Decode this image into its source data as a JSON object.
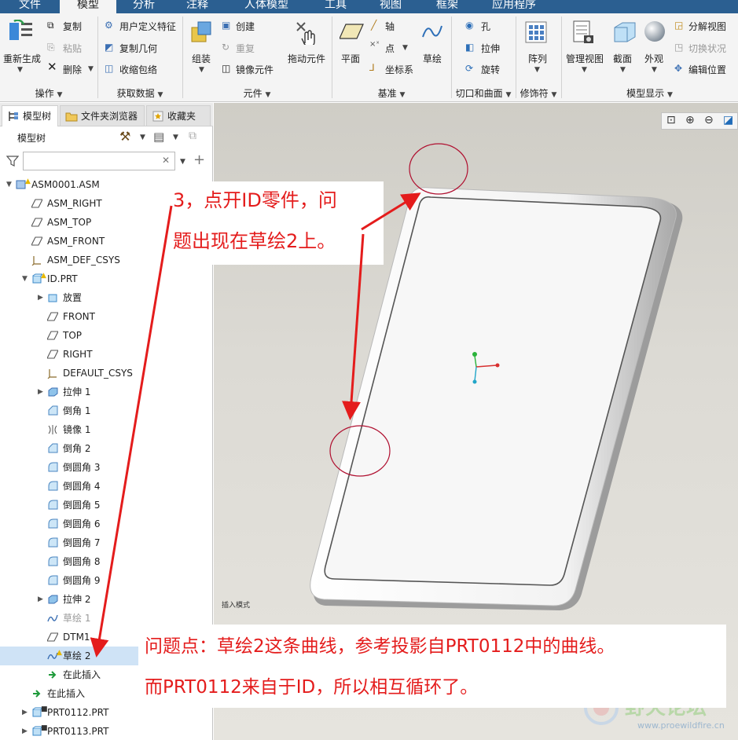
{
  "tabs": [
    "文件",
    "模型",
    "分析",
    "注释",
    "人体模型",
    "工具",
    "视图",
    "框架",
    "应用程序"
  ],
  "ribbon": {
    "operations": {
      "regen": "重新生成",
      "copy": "复制",
      "paste": "粘贴",
      "delete": "删除",
      "group": "操作"
    },
    "get_data": {
      "udf": "用户定义特征",
      "copy_geom": "复制几何",
      "shrinkwrap": "收缩包络",
      "group": "获取数据"
    },
    "component": {
      "assemble": "组装",
      "create": "创建",
      "repeat": "重复",
      "mirror": "镜像元件",
      "drag": "拖动元件",
      "group": "元件"
    },
    "datum": {
      "plane": "平面",
      "axis": "轴",
      "point": "点",
      "csys": "坐标系",
      "sketch": "草绘",
      "group": "基准"
    },
    "cut_surface": {
      "hole": "孔",
      "extrude": "拉伸",
      "revolve": "旋转",
      "group": "切口和曲面"
    },
    "modifier": {
      "pattern": "阵列",
      "group": "修饰符"
    },
    "model_display": {
      "manage_views": "管理视图",
      "section": "截面",
      "appearance": "外观",
      "explode": "分解视图",
      "toggle_status": "切换状况",
      "edit_position": "编辑位置",
      "group": "模型显示"
    }
  },
  "panel_tabs": [
    "模型树",
    "文件夹浏览器",
    "收藏夹"
  ],
  "tree_title": "模型树",
  "search": {
    "value": "",
    "placeholder": ""
  },
  "tree": [
    {
      "label": "ASM0001.ASM",
      "icon": "assembly-icon",
      "indent": 0,
      "expanded": true,
      "warn": true
    },
    {
      "label": "ASM_RIGHT",
      "icon": "datum-plane-icon",
      "indent": 1
    },
    {
      "label": "ASM_TOP",
      "icon": "datum-plane-icon",
      "indent": 1
    },
    {
      "label": "ASM_FRONT",
      "icon": "datum-plane-icon",
      "indent": 1
    },
    {
      "label": "ASM_DEF_CSYS",
      "icon": "csys-icon",
      "indent": 1
    },
    {
      "label": "ID.PRT",
      "icon": "part-icon",
      "indent": 1,
      "expanded": true,
      "warn": true
    },
    {
      "label": "放置",
      "icon": "placement-icon",
      "indent": 2,
      "collapsed": true
    },
    {
      "label": "FRONT",
      "icon": "datum-plane-icon",
      "indent": 2
    },
    {
      "label": "TOP",
      "icon": "datum-plane-icon",
      "indent": 2
    },
    {
      "label": "RIGHT",
      "icon": "datum-plane-icon",
      "indent": 2
    },
    {
      "label": "DEFAULT_CSYS",
      "icon": "csys-icon",
      "indent": 2
    },
    {
      "label": "拉伸 1",
      "icon": "extrude-icon",
      "indent": 2,
      "collapsed": true
    },
    {
      "label": "倒角 1",
      "icon": "chamfer-icon",
      "indent": 2
    },
    {
      "label": "镜像 1",
      "icon": "mirror-icon",
      "indent": 2
    },
    {
      "label": "倒角 2",
      "icon": "chamfer-icon",
      "indent": 2
    },
    {
      "label": "倒圆角 3",
      "icon": "round-icon",
      "indent": 2
    },
    {
      "label": "倒圆角 4",
      "icon": "round-icon",
      "indent": 2
    },
    {
      "label": "倒圆角 5",
      "icon": "round-icon",
      "indent": 2
    },
    {
      "label": "倒圆角 6",
      "icon": "round-icon",
      "indent": 2
    },
    {
      "label": "倒圆角 7",
      "icon": "round-icon",
      "indent": 2
    },
    {
      "label": "倒圆角 8",
      "icon": "round-icon",
      "indent": 2
    },
    {
      "label": "倒圆角 9",
      "icon": "round-icon",
      "indent": 2
    },
    {
      "label": "拉伸 2",
      "icon": "extrude-icon",
      "indent": 2,
      "collapsed": true
    },
    {
      "label": "草绘 1",
      "icon": "sketch-icon",
      "indent": 2,
      "dim": true
    },
    {
      "label": "DTM1",
      "icon": "datum-plane-icon",
      "indent": 2
    },
    {
      "label": "草绘 2",
      "icon": "sketch-icon",
      "indent": 2,
      "selected": true,
      "warn": true
    },
    {
      "label": "在此插入",
      "icon": "insert-here-icon",
      "indent": 2
    },
    {
      "label": "在此插入",
      "icon": "insert-here-icon",
      "indent": 1
    },
    {
      "label": "PRT0112.PRT",
      "icon": "part-icon",
      "indent": 1,
      "collapsed": true,
      "mark": true
    },
    {
      "label": "PRT0113.PRT",
      "icon": "part-icon",
      "indent": 1,
      "collapsed": true,
      "mark": true
    }
  ],
  "viewport": {
    "mode_label": "插入模式"
  },
  "annotations": {
    "step_line1": "3，点开ID零件，问",
    "step_line2": "题出现在草绘2上。",
    "problem_line1": "问题点：草绘2这条曲线，参考投影自PRT0112中的曲线。",
    "problem_line2": "而PRT0112来自于ID，所以相互循环了。"
  },
  "watermark": {
    "name": "野火论坛",
    "url": "www.proewildfire.cn"
  },
  "colors": {
    "annotation_red": "#e41c1c",
    "tab_bar": "#2b5f91",
    "selection": "#cfe3f6"
  }
}
